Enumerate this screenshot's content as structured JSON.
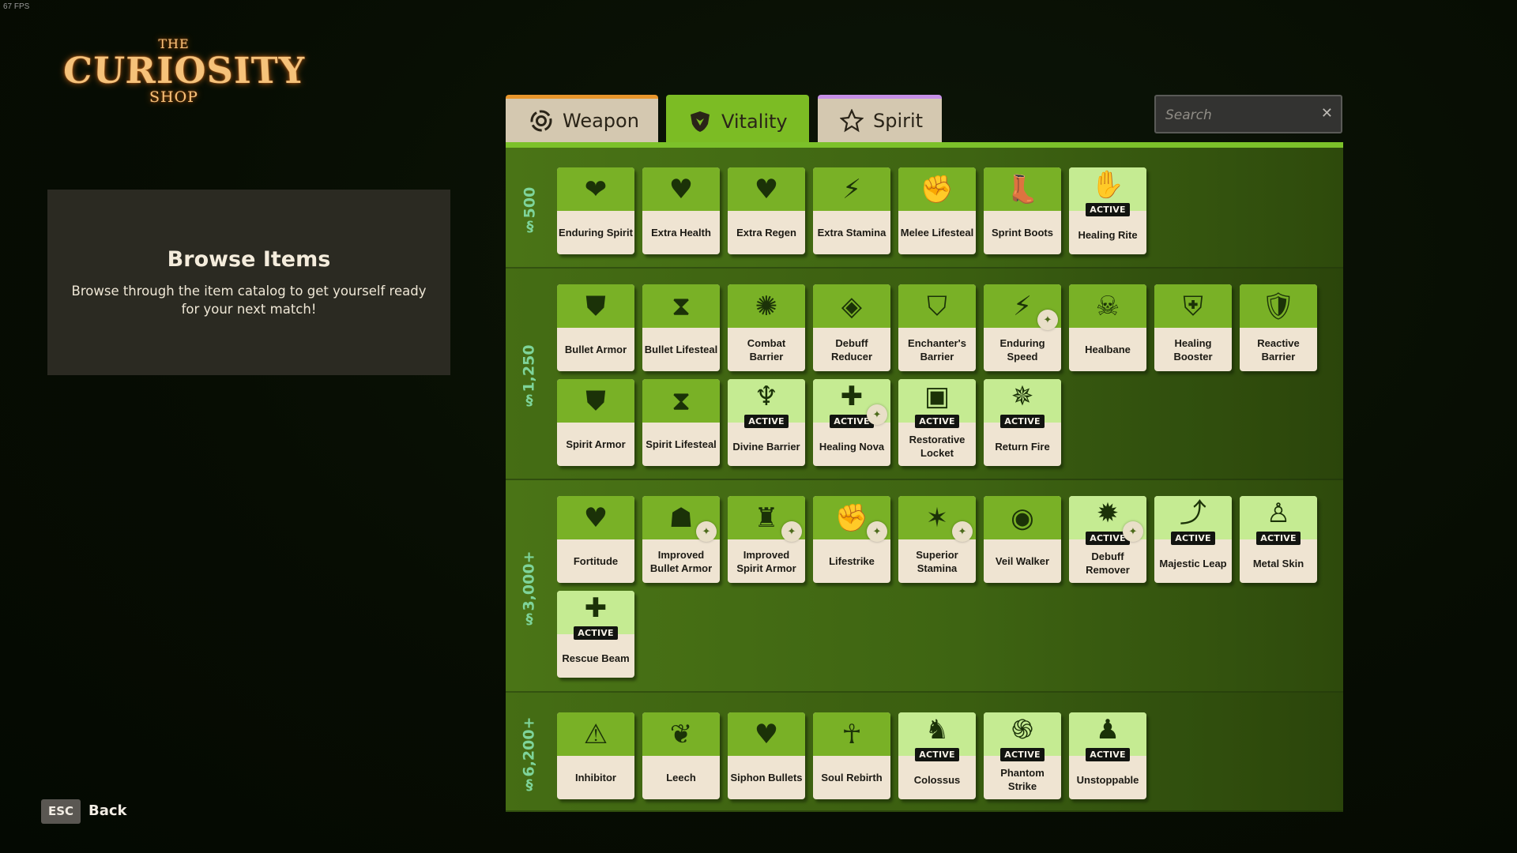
{
  "fps": "67 FPS",
  "logo": {
    "the": "THE",
    "main": "CURIOSITY",
    "shop": "SHOP"
  },
  "info": {
    "title": "Browse Items",
    "description": "Browse through the item catalog to get yourself ready for your next match!"
  },
  "tabs": [
    {
      "label": "Weapon",
      "icon": "weapon-crosshair-icon",
      "accent": "#e8962c",
      "selected": false
    },
    {
      "label": "Vitality",
      "icon": "vitality-shield-icon",
      "accent": "#7cbc24",
      "selected": true
    },
    {
      "label": "Spirit",
      "icon": "spirit-star-icon",
      "accent": "#c690e6",
      "selected": false
    }
  ],
  "search": {
    "placeholder": "Search",
    "value": "",
    "clear_label": "✕"
  },
  "active_badge": "ACTIVE",
  "colors": {
    "panel": "#46700f",
    "card_icon_bg": "#79b126",
    "card_active_icon_bg": "#c5eb92",
    "card_label_bg": "#efe4d2",
    "cost_text": "#7ed49a"
  },
  "sections": [
    {
      "cost": "500",
      "items": [
        {
          "name": "Enduring Spirit",
          "icon": "❤",
          "icon_name": "enduring-spirit-icon",
          "active": false,
          "upgrade": false
        },
        {
          "name": "Extra Health",
          "icon": "♥",
          "icon_name": "extra-health-icon",
          "active": false,
          "upgrade": false
        },
        {
          "name": "Extra Regen",
          "icon": "♥",
          "icon_name": "extra-regen-icon",
          "active": false,
          "upgrade": false
        },
        {
          "name": "Extra Stamina",
          "icon": "⚡",
          "icon_name": "extra-stamina-icon",
          "active": false,
          "upgrade": false
        },
        {
          "name": "Melee Lifesteal",
          "icon": "✊",
          "icon_name": "melee-lifesteal-icon",
          "active": false,
          "upgrade": false
        },
        {
          "name": "Sprint Boots",
          "icon": "👢",
          "icon_name": "sprint-boots-icon",
          "active": false,
          "upgrade": false
        },
        {
          "name": "Healing Rite",
          "icon": "✋",
          "icon_name": "healing-rite-icon",
          "active": true,
          "upgrade": false
        }
      ]
    },
    {
      "cost": "1,250",
      "items": [
        {
          "name": "Bullet Armor",
          "icon": "⛊",
          "icon_name": "bullet-armor-icon",
          "active": false,
          "upgrade": false
        },
        {
          "name": "Bullet Lifesteal",
          "icon": "⧗",
          "icon_name": "bullet-lifesteal-icon",
          "active": false,
          "upgrade": false
        },
        {
          "name": "Combat Barrier",
          "icon": "✺",
          "icon_name": "combat-barrier-icon",
          "active": false,
          "upgrade": false
        },
        {
          "name": "Debuff Reducer",
          "icon": "◈",
          "icon_name": "debuff-reducer-icon",
          "active": false,
          "upgrade": false
        },
        {
          "name": "Enchanter's Barrier",
          "icon": "⛉",
          "icon_name": "enchanters-barrier-icon",
          "active": false,
          "upgrade": false
        },
        {
          "name": "Enduring Speed",
          "icon": "⚡",
          "icon_name": "enduring-speed-icon",
          "active": false,
          "upgrade": true
        },
        {
          "name": "Healbane",
          "icon": "☠",
          "icon_name": "healbane-icon",
          "active": false,
          "upgrade": false
        },
        {
          "name": "Healing Booster",
          "icon": "⛨",
          "icon_name": "healing-booster-icon",
          "active": false,
          "upgrade": false
        },
        {
          "name": "Reactive Barrier",
          "icon": "🛡",
          "icon_name": "reactive-barrier-icon",
          "active": false,
          "upgrade": false
        },
        {
          "name": "Spirit Armor",
          "icon": "⛊",
          "icon_name": "spirit-armor-icon",
          "active": false,
          "upgrade": false
        },
        {
          "name": "Spirit Lifesteal",
          "icon": "⧗",
          "icon_name": "spirit-lifesteal-icon",
          "active": false,
          "upgrade": false
        },
        {
          "name": "Divine Barrier",
          "icon": "♆",
          "icon_name": "divine-barrier-icon",
          "active": true,
          "upgrade": false
        },
        {
          "name": "Healing Nova",
          "icon": "✚",
          "icon_name": "healing-nova-icon",
          "active": true,
          "upgrade": true
        },
        {
          "name": "Restorative Locket",
          "icon": "▣",
          "icon_name": "restorative-locket-icon",
          "active": true,
          "upgrade": false
        },
        {
          "name": "Return Fire",
          "icon": "✵",
          "icon_name": "return-fire-icon",
          "active": true,
          "upgrade": false
        }
      ]
    },
    {
      "cost": "3,000+",
      "items": [
        {
          "name": "Fortitude",
          "icon": "♥",
          "icon_name": "fortitude-icon",
          "active": false,
          "upgrade": false
        },
        {
          "name": "Improved Bullet Armor",
          "icon": "☗",
          "icon_name": "improved-bullet-armor-icon",
          "active": false,
          "upgrade": true
        },
        {
          "name": "Improved Spirit Armor",
          "icon": "♜",
          "icon_name": "improved-spirit-armor-icon",
          "active": false,
          "upgrade": true
        },
        {
          "name": "Lifestrike",
          "icon": "✊",
          "icon_name": "lifestrike-icon",
          "active": false,
          "upgrade": true
        },
        {
          "name": "Superior Stamina",
          "icon": "✶",
          "icon_name": "superior-stamina-icon",
          "active": false,
          "upgrade": true
        },
        {
          "name": "Veil Walker",
          "icon": "◉",
          "icon_name": "veil-walker-icon",
          "active": false,
          "upgrade": false
        },
        {
          "name": "Debuff Remover",
          "icon": "✹",
          "icon_name": "debuff-remover-icon",
          "active": true,
          "upgrade": true
        },
        {
          "name": "Majestic Leap",
          "icon": "⤴",
          "icon_name": "majestic-leap-icon",
          "active": true,
          "upgrade": false
        },
        {
          "name": "Metal Skin",
          "icon": "♙",
          "icon_name": "metal-skin-icon",
          "active": true,
          "upgrade": false
        },
        {
          "name": "Rescue Beam",
          "icon": "✚",
          "icon_name": "rescue-beam-icon",
          "active": true,
          "upgrade": false
        }
      ]
    },
    {
      "cost": "6,200+",
      "items": [
        {
          "name": "Inhibitor",
          "icon": "⚠",
          "icon_name": "inhibitor-icon",
          "active": false,
          "upgrade": false
        },
        {
          "name": "Leech",
          "icon": "❦",
          "icon_name": "leech-icon",
          "active": false,
          "upgrade": false
        },
        {
          "name": "Siphon Bullets",
          "icon": "♥",
          "icon_name": "siphon-bullets-icon",
          "active": false,
          "upgrade": false
        },
        {
          "name": "Soul Rebirth",
          "icon": "☥",
          "icon_name": "soul-rebirth-icon",
          "active": false,
          "upgrade": false
        },
        {
          "name": "Colossus",
          "icon": "♞",
          "icon_name": "colossus-icon",
          "active": true,
          "upgrade": false
        },
        {
          "name": "Phantom Strike",
          "icon": "֍",
          "icon_name": "phantom-strike-icon",
          "active": true,
          "upgrade": false
        },
        {
          "name": "Unstoppable",
          "icon": "♟",
          "icon_name": "unstoppable-icon",
          "active": true,
          "upgrade": false
        }
      ]
    }
  ],
  "footer": {
    "key": "ESC",
    "label": "Back"
  }
}
